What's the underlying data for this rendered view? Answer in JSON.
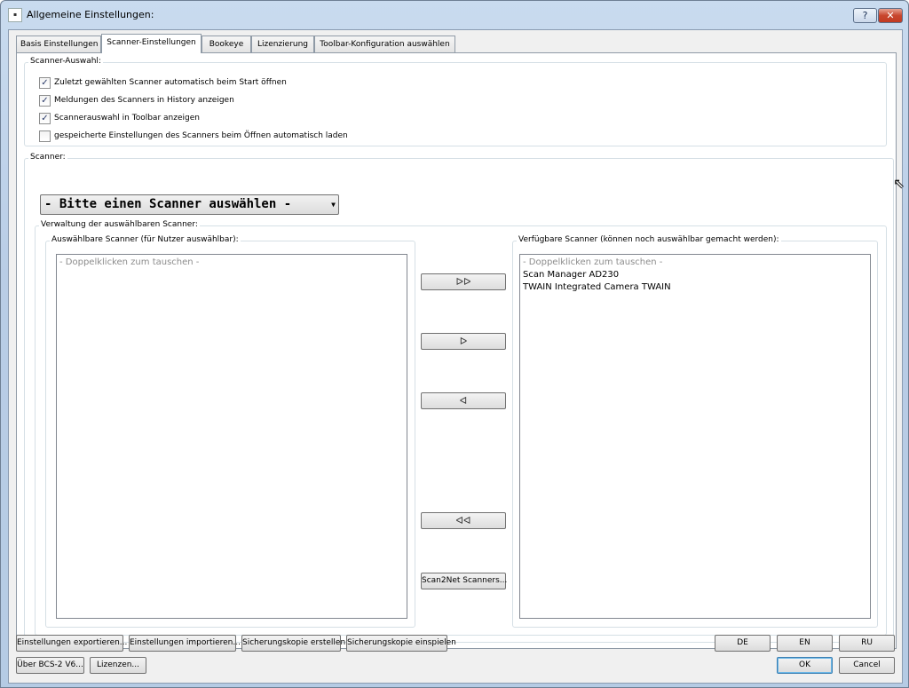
{
  "window": {
    "title": "Allgemeine Einstellungen:",
    "help_label": "?",
    "close_label": "✕",
    "icon_label": "▪"
  },
  "tabs": [
    "Basis Einstellungen",
    "Scanner-Einstellungen",
    "Bookeye",
    "Lizenzierung",
    "Toolbar-Konfiguration auswählen"
  ],
  "scanner_auswahl": {
    "label": "Scanner-Auswahl:",
    "options": [
      {
        "label": "Zuletzt gewählten Scanner automatisch beim Start öffnen",
        "checked": true
      },
      {
        "label": "Meldungen des Scanners in History anzeigen",
        "checked": true
      },
      {
        "label": "Scannerauswahl in Toolbar anzeigen",
        "checked": true
      },
      {
        "label": "gespeicherte Einstellungen des Scanners beim Öffnen automatisch laden",
        "checked": false
      }
    ]
  },
  "scanner": {
    "label": "Scanner:",
    "combo_value": "- Bitte einen Scanner auswählen -",
    "verwaltung_label": "Verwaltung der auswählbaren Scanner:",
    "left_list": {
      "label": "Auswählbare Scanner (für Nutzer auswählbar):",
      "placeholder": "- Doppelklicken zum tauschen -",
      "items": []
    },
    "right_list": {
      "label": "Verfügbare Scanner (können noch auswählbar gemacht werden):",
      "placeholder": "- Doppelklicken zum tauschen -",
      "items": [
        "Scan Manager AD230",
        "TWAIN Integrated Camera TWAIN"
      ]
    },
    "move_buttons": {
      "all_left": "ᐅᐅ",
      "one_left": "ᐅ",
      "one_right": "ᐊ",
      "all_right": "ᐊᐊ"
    },
    "scan2net_label": "Scan2Net Scanners..."
  },
  "footer": {
    "export": "Einstellungen exportieren...",
    "import": "Einstellungen importieren...",
    "backup_create": "Sicherungskopie erstellen",
    "backup_restore": "Sicherungskopie einspielen",
    "about": "Über BCS-2 V6...",
    "licenses": "Lizenzen...",
    "lang_de": "DE",
    "lang_en": "EN",
    "lang_ru": "RU",
    "ok": "OK",
    "cancel": "Cancel"
  }
}
